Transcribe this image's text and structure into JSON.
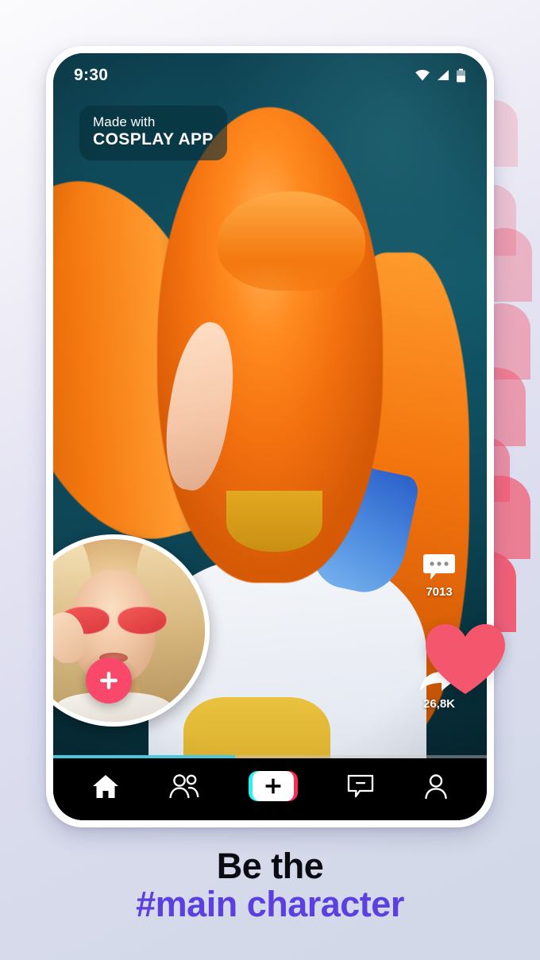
{
  "theme": {
    "bg_top": "#FBFBFD",
    "bg_bottom": "#D2D8E8",
    "accent_purple": "#5B3FE0",
    "accent_pink": "#F9486A",
    "heart_pink": "#F4566E",
    "progress_cyan": "#49C8DC",
    "tiktok_cyan": "#25F4EE",
    "tiktok_red": "#FE2C55",
    "screen_teal": "#0E4050",
    "nav_black": "#000000"
  },
  "phone": {
    "status_bar": {
      "time": "9:30",
      "icons": [
        "wifi-icon",
        "cellular-signal-icon",
        "battery-icon"
      ]
    },
    "watermark": {
      "line1": "Made with",
      "line2": "COSPLAY APP"
    },
    "video": {
      "description": "3D cosplay character with long orange hair, green eyes, white and yellow school uniform on teal background",
      "progress_percent": 42
    },
    "avatar": {
      "name": "creator-avatar",
      "description": "Blonde woman wearing red tinted sunglasses",
      "add_label": "+"
    },
    "actions": [
      {
        "id": "comment",
        "icon": "comment-bubble-icon",
        "count": "7013"
      },
      {
        "id": "like",
        "icon": "heart-icon",
        "count": ""
      },
      {
        "id": "share",
        "icon": "share-arrow-icon",
        "count": "26,8K"
      }
    ],
    "bottom_nav": [
      {
        "id": "home",
        "icon": "home-icon",
        "active": true
      },
      {
        "id": "friends",
        "icon": "friends-icon",
        "active": false
      },
      {
        "id": "create",
        "icon": "plus-icon",
        "active": false
      },
      {
        "id": "inbox",
        "icon": "inbox-icon",
        "active": false
      },
      {
        "id": "profile",
        "icon": "person-icon",
        "active": false
      }
    ]
  },
  "headline": {
    "line1": "Be the",
    "line2": "#main character"
  },
  "decor": {
    "heart_column_count": 8
  }
}
